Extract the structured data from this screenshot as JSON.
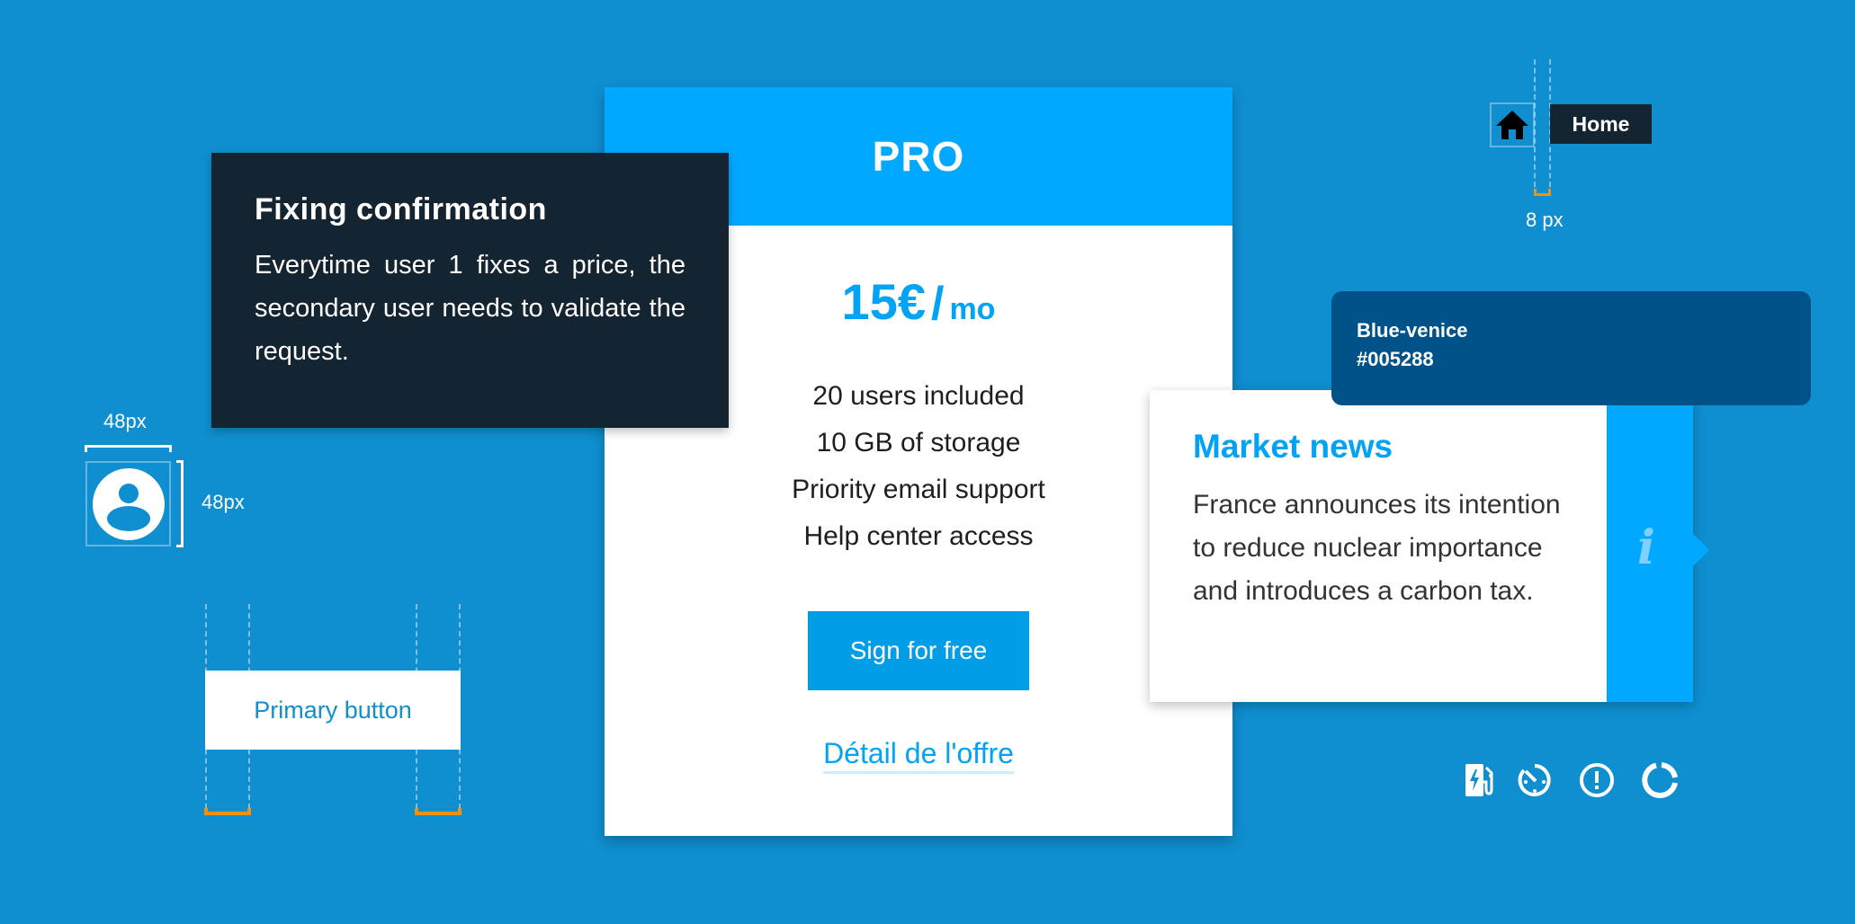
{
  "confirm_card": {
    "title": "Fixing confirmation",
    "body": "Everytime user 1 fixes a price, the secondary user needs to validate the request."
  },
  "pricing_card": {
    "plan": "PRO",
    "price_amount": "15€",
    "price_separator": "/",
    "price_unit": "mo",
    "features": [
      "20 users included",
      "10 GB of storage",
      "Priority email support",
      "Help center access"
    ],
    "cta_label": "Sign for free",
    "detail_link": "Détail de l'offre"
  },
  "color_swatch": {
    "name": "Blue-venice",
    "hex": "#005288"
  },
  "news_card": {
    "title": "Market news",
    "body": "France announces its intention to reduce nuclear importance and introduces a carbon tax.",
    "icon": "info-icon"
  },
  "spacing_spec": {
    "home_label": "Home",
    "gap_label": "8 px",
    "avatar_width_label": "48px",
    "avatar_height_label": "48px",
    "primary_button_label": "Primary button"
  },
  "icons": [
    "ev-charging-station-icon",
    "timer-icon",
    "alert-circle-icon",
    "donut-ring-icon"
  ],
  "colors": {
    "background": "#0f8fd0",
    "accent": "#00a8ff",
    "dark": "#152431",
    "blue_venice": "#005288",
    "spec_orange": "#f0920f"
  }
}
